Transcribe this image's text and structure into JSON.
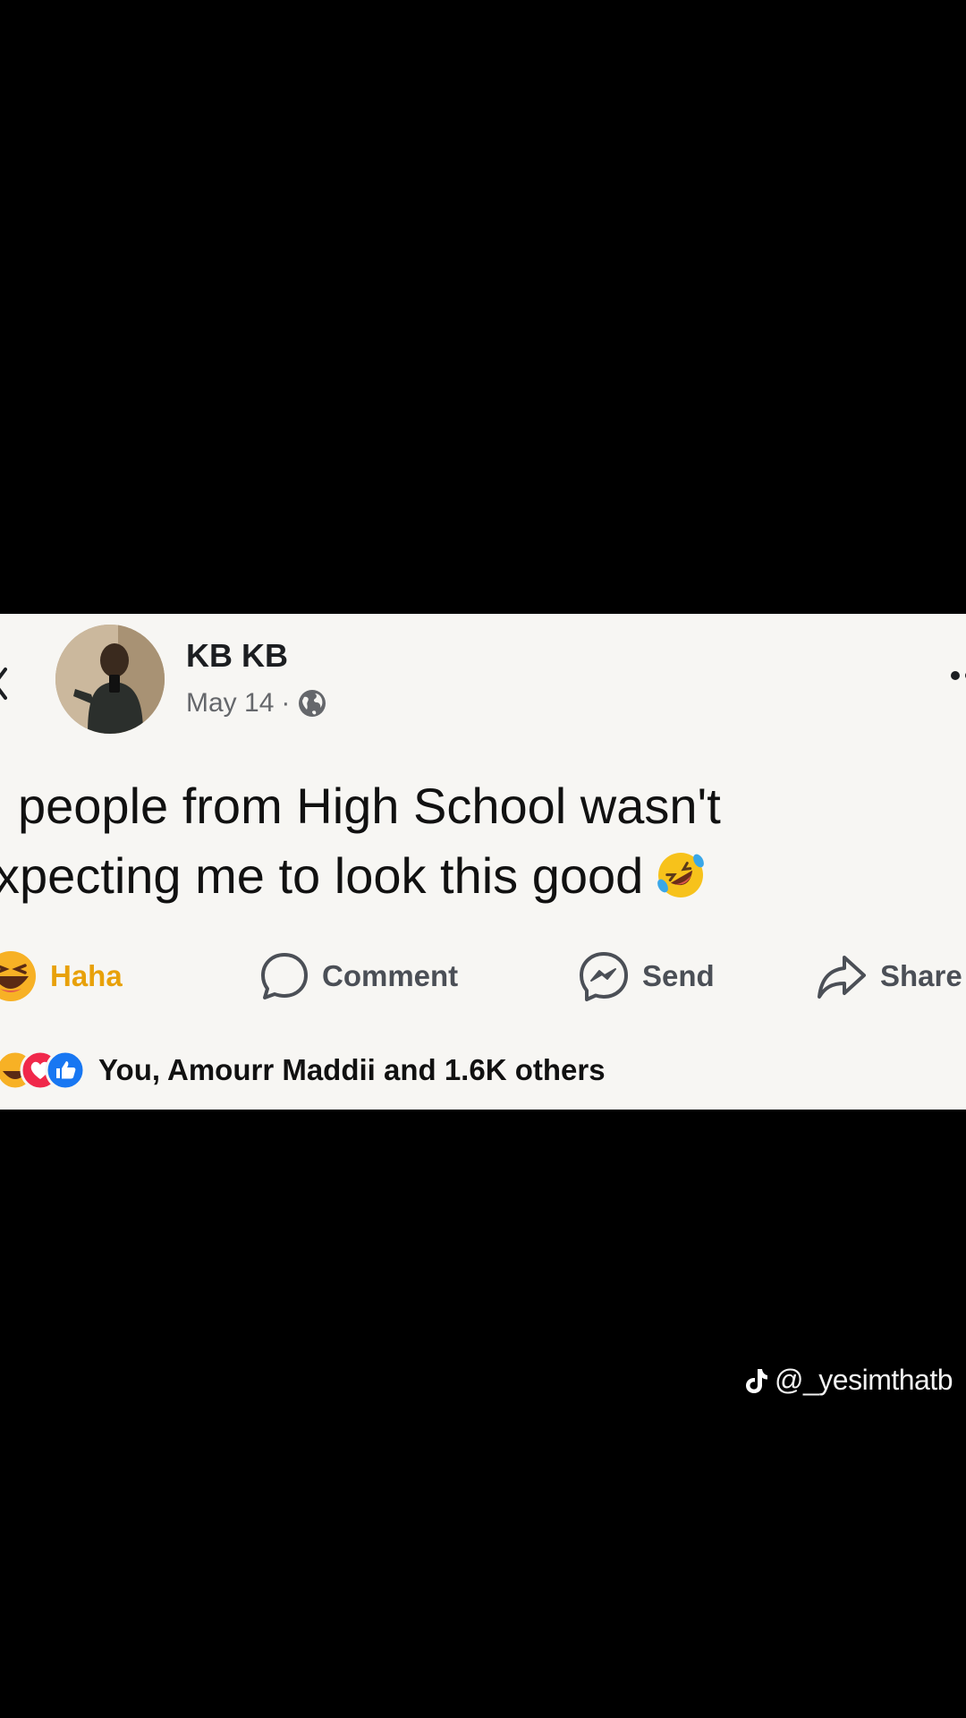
{
  "post": {
    "author": "KB KB",
    "date": "May 14",
    "separator": "·",
    "text_line1": "people from High School wasn't",
    "text_line2": "xpecting me to look this good",
    "emoji_name": "rolling-on-floor-laughing-emoji"
  },
  "actions": {
    "haha": "Haha",
    "comment": "Comment",
    "send": "Send",
    "share": "Share"
  },
  "reactions": {
    "icons": [
      "haha-reaction-icon",
      "love-reaction-icon",
      "like-reaction-icon"
    ],
    "summary": "You, Amourr Maddii and 1.6K others"
  },
  "overlay": {
    "watermark": "@_yesimthatb",
    "watermark_icon": "tiktok-icon"
  },
  "colors": {
    "background": "#000000",
    "card": "#f7f6f3",
    "haha_accent": "#e8a10a",
    "love": "#f0284a",
    "like": "#1877f2"
  }
}
